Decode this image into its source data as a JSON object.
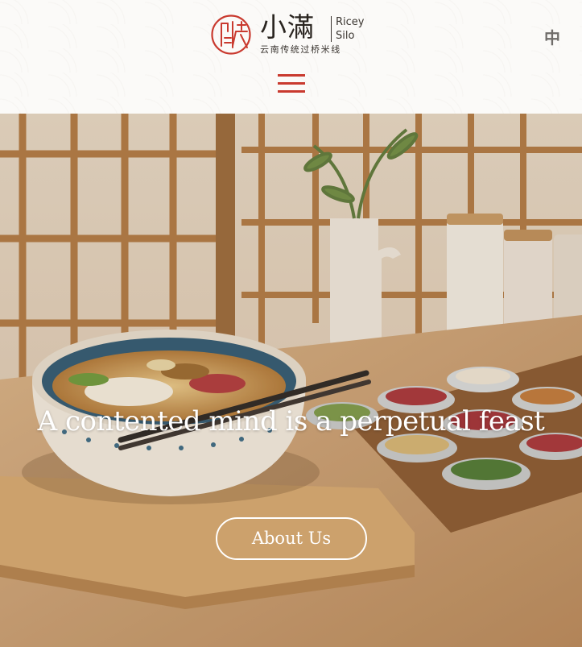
{
  "header": {
    "brand": {
      "chinese_name": "小滿",
      "english_name_line1": "Ricey",
      "english_name_line2": "Silo",
      "tagline": "云南传统过桥米线"
    },
    "language_toggle": "中",
    "menu_icon": "hamburger-menu-icon",
    "accent_color": "#c93a2f"
  },
  "hero": {
    "title": "A contented mind is a perpetual feast",
    "cta_label": "About Us"
  }
}
